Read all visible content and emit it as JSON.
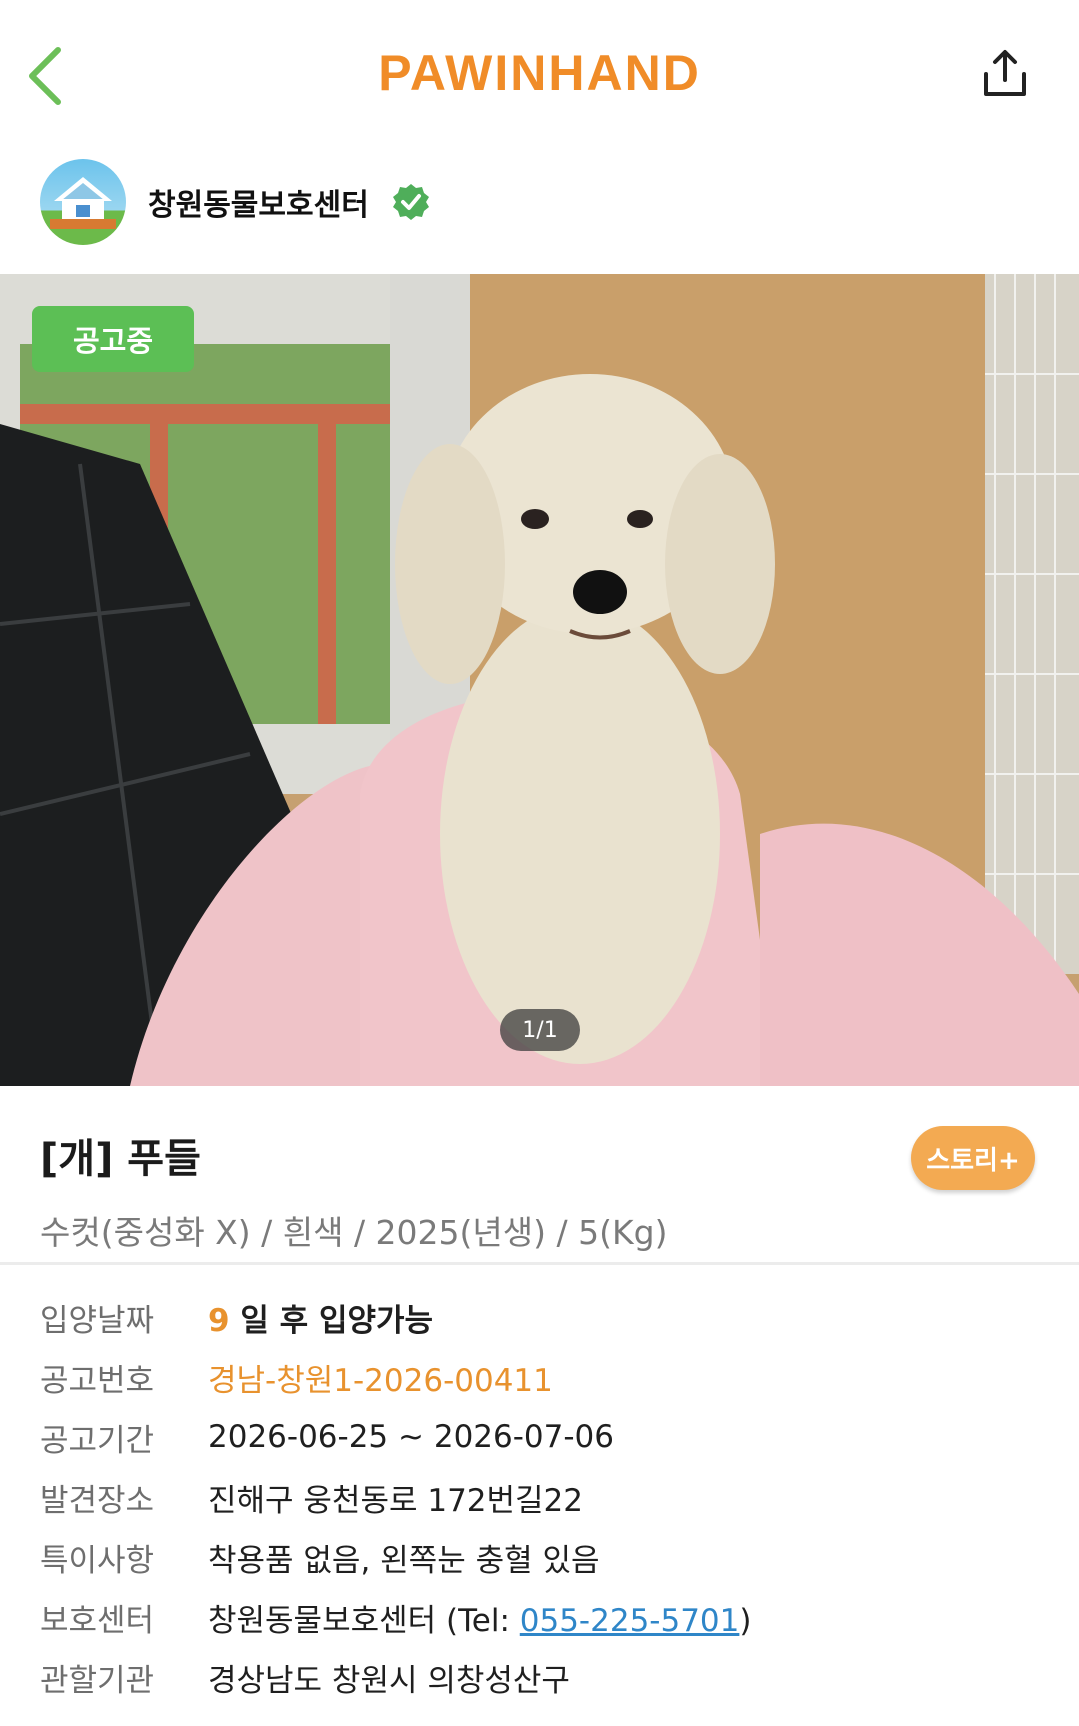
{
  "header": {
    "brand": "PAWINHAND",
    "back_icon": "chevron-left-icon",
    "share_icon": "share-icon",
    "accent_color": "#f08c28"
  },
  "shelter": {
    "name": "창원동물보호센터",
    "verified_icon": "verified-badge-icon"
  },
  "photo": {
    "status_badge": "공고중",
    "counter": "1/1"
  },
  "pet": {
    "title": "[개] 푸들",
    "summary": "수컷(중성화 X) / 흰색 / 2025(년생) / 5(Kg)",
    "story_button": "스토리+"
  },
  "info": {
    "adoption_label": "입양날짜",
    "adoption_days": "9",
    "adoption_text": " 일 후 입양가능",
    "notice_label": "공고번호",
    "notice_value": "경남-창원1-2026-00411",
    "period_label": "공고기간",
    "period_value": "2026-06-25 ~ 2026-07-06",
    "found_label": "발견장소",
    "found_value": "진해구 웅천동로 172번길22",
    "special_label": "특이사항",
    "special_value": "착용품 없음, 왼쪽눈 충혈 있음",
    "center_label": "보호센터",
    "center_prefix": "창원동물보호센터 (Tel: ",
    "center_tel": "055-225-5701",
    "center_suffix": ")",
    "agency_label": "관할기관",
    "agency_value": "경상남도 창원시 의창성산구"
  }
}
